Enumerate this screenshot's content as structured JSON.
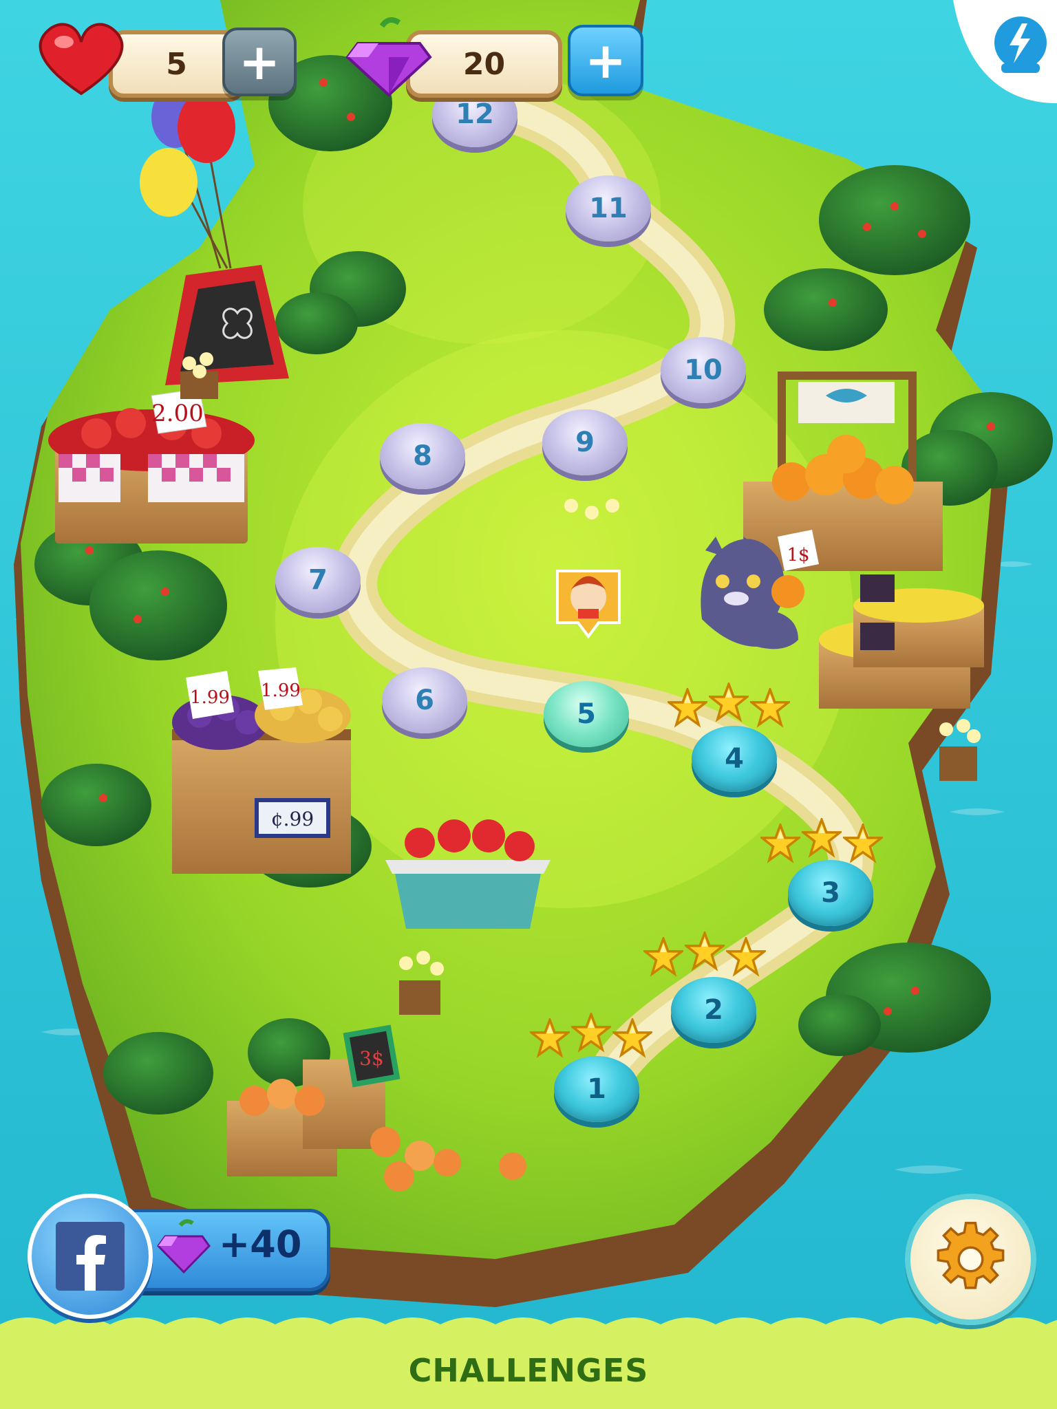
{
  "hud": {
    "lives": "5",
    "gems": "20",
    "lives_icon": "heart-icon",
    "gems_icon": "gem-icon",
    "plus_icon": "plus-icon",
    "boost_icon": "lightning-icon"
  },
  "levels": [
    {
      "number": "1",
      "status": "completed",
      "stars": 3
    },
    {
      "number": "2",
      "status": "completed",
      "stars": 3
    },
    {
      "number": "3",
      "status": "completed",
      "stars": 3
    },
    {
      "number": "4",
      "status": "completed",
      "stars": 3
    },
    {
      "number": "5",
      "status": "current",
      "stars": 0
    },
    {
      "number": "6",
      "status": "locked",
      "stars": 0
    },
    {
      "number": "7",
      "status": "locked",
      "stars": 0
    },
    {
      "number": "8",
      "status": "locked",
      "stars": 0
    },
    {
      "number": "9",
      "status": "locked",
      "stars": 0
    },
    {
      "number": "10",
      "status": "locked",
      "stars": 0
    },
    {
      "number": "11",
      "status": "locked",
      "stars": 0
    },
    {
      "number": "12",
      "status": "locked",
      "stars": 0
    }
  ],
  "signs": {
    "apples_price": "2.00",
    "plums_price": "1.99",
    "lemons_price": "1.99",
    "crate_price": "¢.99",
    "oranges_price": "1$",
    "peaches_price": "3$"
  },
  "facebook": {
    "icon": "facebook-icon",
    "gem_icon": "gem-icon",
    "reward": "+40"
  },
  "settings_icon": "gear-icon",
  "footer": {
    "challenges_label": "CHALLENGES"
  },
  "colors": {
    "water": "#2cc6d6",
    "grass": "#8fd11f",
    "path": "#f2e6a6",
    "accent_blue": "#1f9bde",
    "gem_purple": "#b23ee0",
    "heart_red": "#e0202a",
    "challenges_green": "#2e6d14"
  }
}
